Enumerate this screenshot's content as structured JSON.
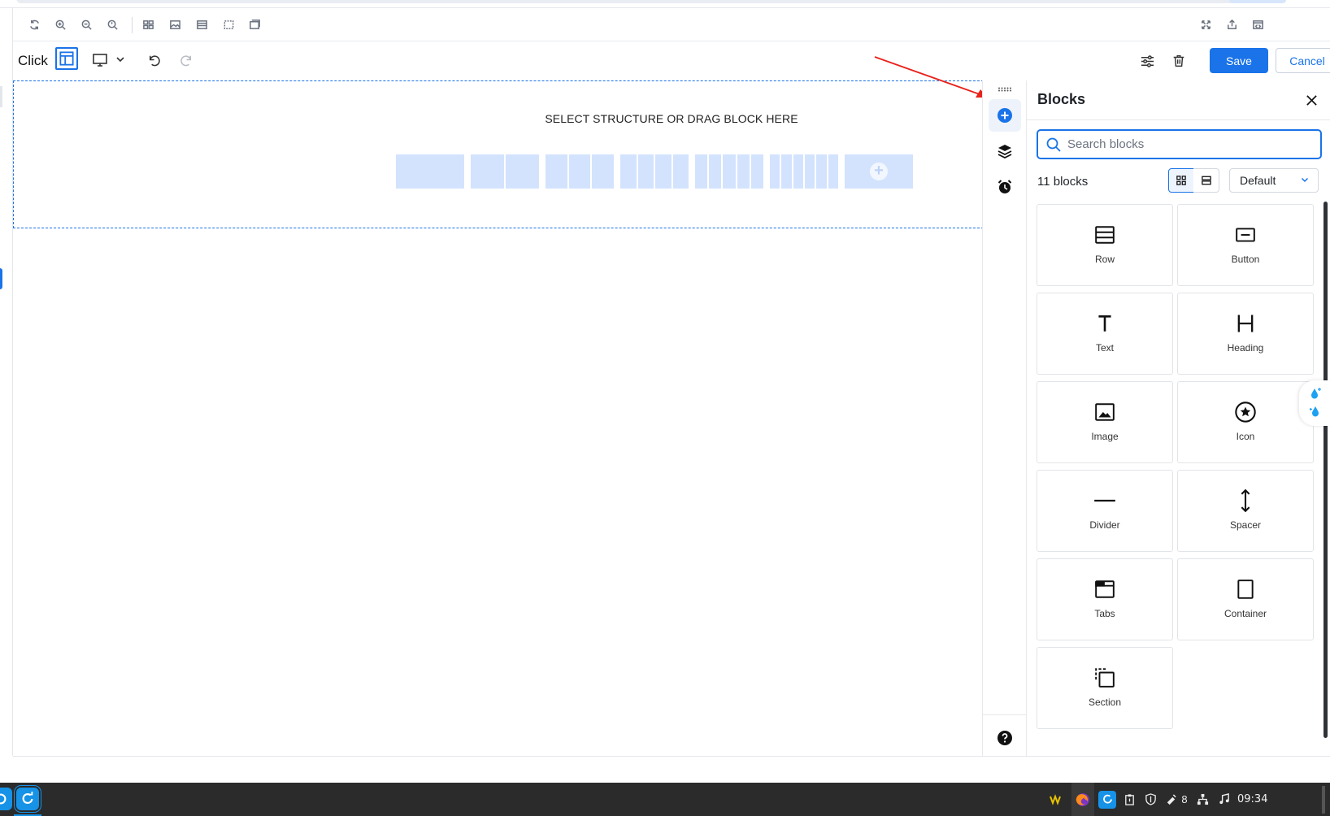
{
  "app": {
    "brand": "Click"
  },
  "toolbar": {
    "save_label": "Save",
    "cancel_label": "Cancel"
  },
  "canvas": {
    "drop_text": "SELECT STRUCTURE OR DRAG BLOCK HERE",
    "structures": [
      {
        "name": "structure-1-column",
        "columns": 1
      },
      {
        "name": "structure-2-columns",
        "columns": 2
      },
      {
        "name": "structure-3-columns",
        "columns": 3
      },
      {
        "name": "structure-4-columns",
        "columns": 4
      },
      {
        "name": "structure-5-columns",
        "columns": 5
      },
      {
        "name": "structure-6-columns",
        "columns": 6
      }
    ]
  },
  "panel": {
    "title": "Blocks",
    "search_placeholder": "Search blocks",
    "count": "11 blocks",
    "sort_value": "Default",
    "blocks": [
      {
        "label": "Row",
        "icon": "row-icon"
      },
      {
        "label": "Button",
        "icon": "button-icon"
      },
      {
        "label": "Text",
        "icon": "text-icon"
      },
      {
        "label": "Heading",
        "icon": "heading-icon"
      },
      {
        "label": "Image",
        "icon": "image-icon"
      },
      {
        "label": "Icon",
        "icon": "star-circle-icon"
      },
      {
        "label": "Divider",
        "icon": "divider-icon"
      },
      {
        "label": "Spacer",
        "icon": "spacer-icon"
      },
      {
        "label": "Tabs",
        "icon": "tabs-icon"
      },
      {
        "label": "Container",
        "icon": "container-icon"
      },
      {
        "label": "Section",
        "icon": "section-icon"
      }
    ]
  },
  "taskbar": {
    "tray_count": "8",
    "clock": "09:34"
  },
  "colors": {
    "accent": "#1a73e8",
    "structure_fill": "#d3e3fd",
    "annotation_arrow": "#e8221b",
    "taskbar": "#2b2b2b"
  }
}
